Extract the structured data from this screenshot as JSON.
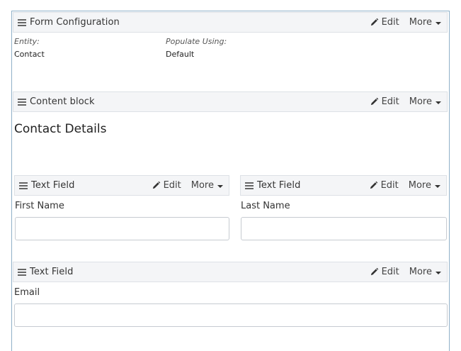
{
  "actions": {
    "edit_label": "Edit",
    "more_label": "More",
    "edit_icon": "pencil-icon",
    "more_icon": "caret-down-icon",
    "drag_icon": "drag-handle-icon"
  },
  "form_configuration": {
    "title": "Form Configuration",
    "entity_label": "Entity:",
    "entity_value": "Contact",
    "populate_label": "Populate Using:",
    "populate_value": "Default"
  },
  "content_block": {
    "title": "Content block",
    "heading": "Contact Details"
  },
  "text_fields": [
    {
      "title": "Text Field",
      "label": "First Name",
      "value": "",
      "placeholder": ""
    },
    {
      "title": "Text Field",
      "label": "Last Name",
      "value": "",
      "placeholder": ""
    },
    {
      "title": "Text Field",
      "label": "Email",
      "value": "",
      "placeholder": ""
    }
  ],
  "colors": {
    "container_border": "#8fb0c8",
    "bar_background": "#f4f5f7",
    "bar_border": "#dde1e6"
  }
}
